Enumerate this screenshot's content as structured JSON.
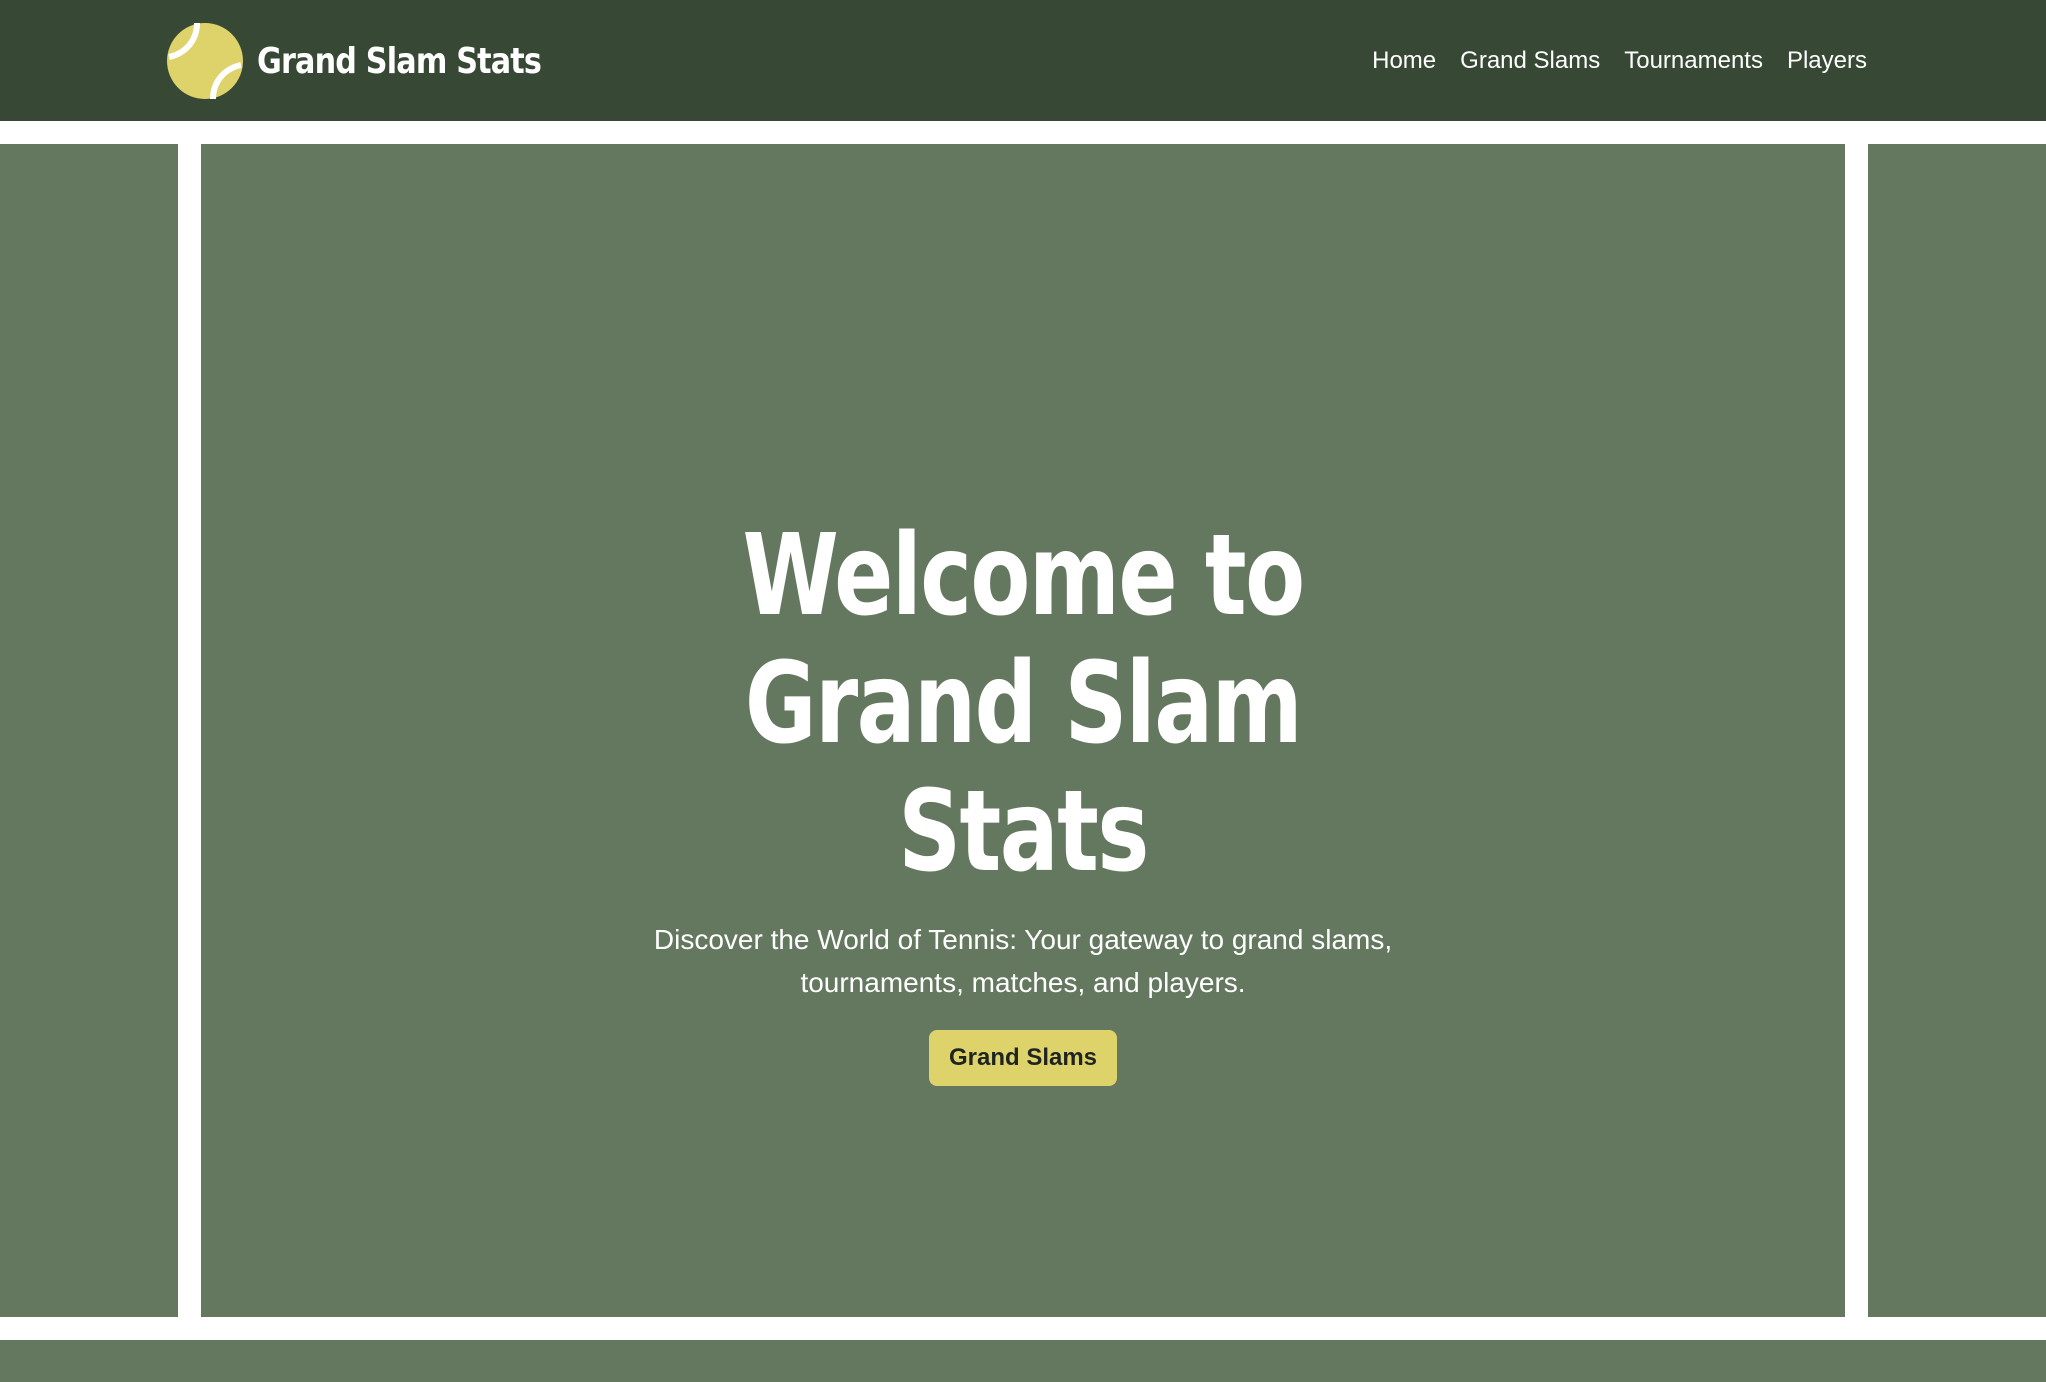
{
  "header": {
    "brand_name": "Grand Slam Stats",
    "logo_icon": "tennis-ball-icon",
    "nav": [
      {
        "label": "Home"
      },
      {
        "label": "Grand Slams"
      },
      {
        "label": "Tournaments"
      },
      {
        "label": "Players"
      }
    ]
  },
  "hero": {
    "title": "Welcome to Grand Slam Stats",
    "subtitle": "Discover the World of Tennis: Your gateway to grand slams, tournaments, matches, and players.",
    "cta_label": "Grand Slams"
  },
  "colors": {
    "header_bg": "#374835",
    "court_green": "#64775f",
    "court_lines": "#ffffff",
    "accent_yellow": "#ddd36a"
  }
}
